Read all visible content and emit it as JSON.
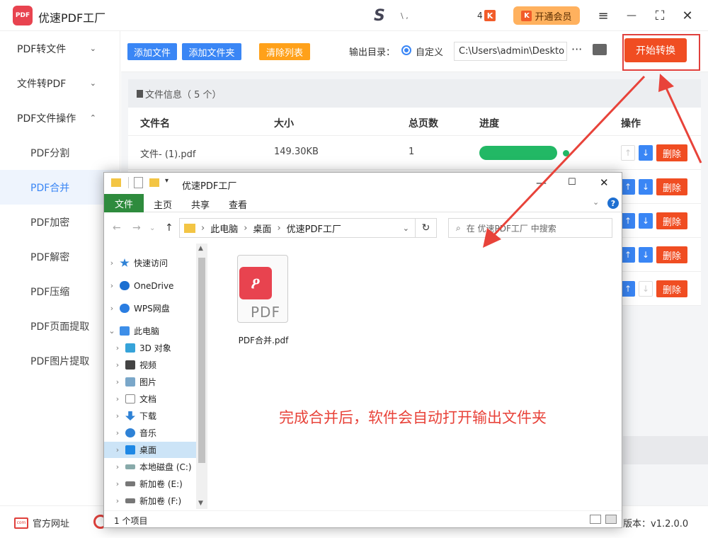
{
  "app": {
    "title": "优速PDF工厂",
    "logo_text": "PDF",
    "brand_mark": "S",
    "brand_mark_text": "\\ ,",
    "badge_count": "4",
    "vip_icon": "K",
    "vip_label": "开通会员"
  },
  "window_controls": {
    "menu": "≡",
    "minimize": "—",
    "maximize": "⛶",
    "close": "✕"
  },
  "sidebar": {
    "items": [
      {
        "label": "PDF转文件",
        "chev": "⌄"
      },
      {
        "label": "文件转PDF",
        "chev": "⌄"
      },
      {
        "label": "PDF文件操作",
        "chev": "⌃"
      },
      {
        "label": "PDF分割"
      },
      {
        "label": "PDF合并"
      },
      {
        "label": "PDF加密"
      },
      {
        "label": "PDF解密"
      },
      {
        "label": "PDF压缩"
      },
      {
        "label": "PDF页面提取"
      },
      {
        "label": "PDF图片提取"
      }
    ]
  },
  "toolbar": {
    "add_file": "添加文件",
    "add_folder": "添加文件夹",
    "clear_list": "清除列表",
    "output_label": "输出目录：",
    "radio_label": "自定义",
    "output_path": "C:\\Users\\admin\\Deskto",
    "more": "···",
    "start": "开始转换"
  },
  "file_table": {
    "info_label": "文件信息（ 5 个）",
    "headers": {
      "name": "文件名",
      "size": "大小",
      "pages": "总页数",
      "progress": "进度",
      "action": "操作"
    },
    "rows": [
      {
        "name": "文件- (1).pdf",
        "size": "149.30KB",
        "pages": "1",
        "progress": 1.0,
        "delete": "删除"
      },
      {
        "delete": "删除"
      },
      {
        "delete": "删除"
      },
      {
        "delete": "删除"
      },
      {
        "delete": "删除"
      }
    ],
    "up_icon": "↑",
    "down_icon": "↓"
  },
  "footer": {
    "site_icon": "com",
    "site_label": "官方网址",
    "version": "版本：v1.2.0.0"
  },
  "explorer": {
    "title": "优速PDF工厂",
    "ribbon": {
      "file": "文件",
      "tabs": [
        "主页",
        "共享",
        "查看"
      ]
    },
    "help": "?",
    "address": [
      "此电脑",
      "桌面",
      "优速PDF工厂"
    ],
    "address_sep": "›",
    "search_placeholder": "在 优速PDF工厂 中搜索",
    "tree": [
      {
        "label": "快速访问",
        "icon": "star-icon"
      },
      {
        "label": "OneDrive",
        "icon": "cloud-icon"
      },
      {
        "label": "WPS网盘",
        "icon": "cloud-icon"
      },
      {
        "label": "此电脑",
        "icon": "computer-icon"
      },
      {
        "label": "3D 对象",
        "icon": "cube-icon"
      },
      {
        "label": "视频",
        "icon": "film-icon"
      },
      {
        "label": "图片",
        "icon": "image-icon"
      },
      {
        "label": "文档",
        "icon": "document-icon"
      },
      {
        "label": "下载",
        "icon": "download-icon"
      },
      {
        "label": "音乐",
        "icon": "music-icon"
      },
      {
        "label": "桌面",
        "icon": "desktop-icon"
      },
      {
        "label": "本地磁盘 (C:)",
        "icon": "drive-icon"
      },
      {
        "label": "新加卷 (E:)",
        "icon": "drive-icon"
      },
      {
        "label": "新加卷 (F:)",
        "icon": "drive-icon"
      }
    ],
    "file": {
      "name": "PDF合并.pdf",
      "type_text": "PDF",
      "badge_text": "ዖ"
    },
    "status": "1 个项目"
  },
  "annotation": "完成合并后，软件会自动打开输出文件夹",
  "colors": {
    "accent": "#3a86f5",
    "danger": "#f04d22",
    "success": "#22b865",
    "annotation": "#e8433a"
  }
}
